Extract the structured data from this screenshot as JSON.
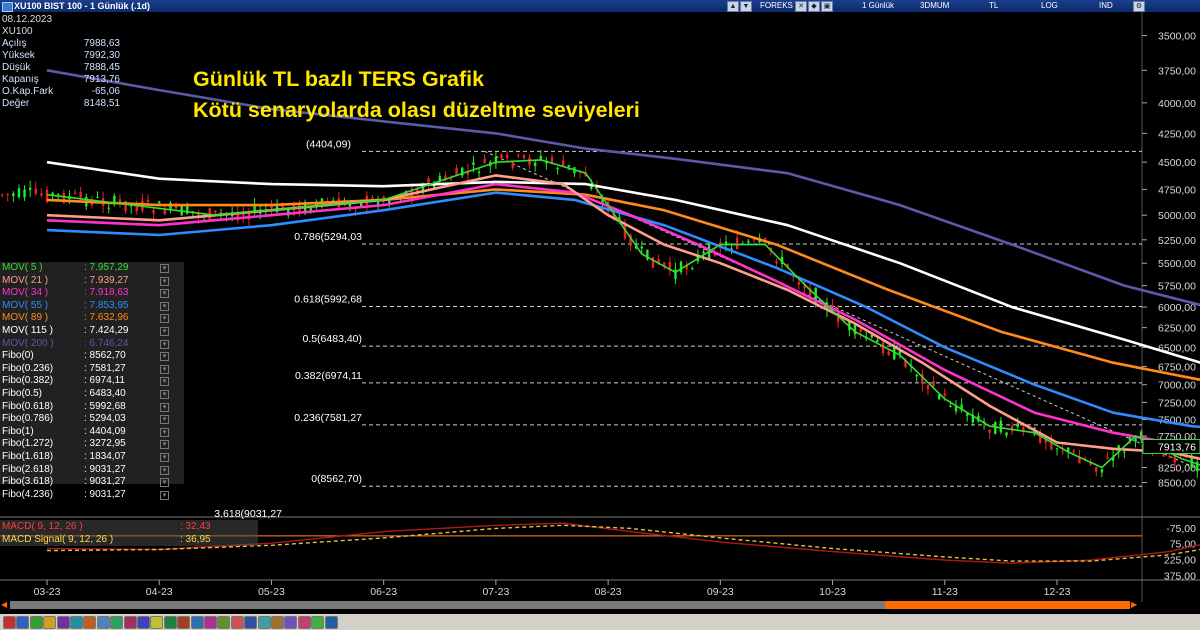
{
  "window": {
    "title": "XU100 BIST 100 - 1 Günlük (.1d)",
    "toolbar_items": [
      "FOREKS",
      "1 Günlük",
      "3DMUM",
      "TL",
      "LOG",
      "IND"
    ]
  },
  "info_panel": {
    "date": "08.12.2023",
    "symbol": "XU100",
    "rows": [
      {
        "label": "Açılış",
        "value": "7988,63"
      },
      {
        "label": "Yüksek",
        "value": "7992,30"
      },
      {
        "label": "Düşük",
        "value": "7888,45"
      },
      {
        "label": "Kapanış",
        "value": "7913,76"
      },
      {
        "label": "O.Kap.Fark",
        "value": "-65,06"
      },
      {
        "label": "Değer",
        "value": "8148,51"
      }
    ]
  },
  "headline": {
    "line1": "Günlük TL bazlı TERS Grafik",
    "line2": "Kötü senaryolarda olası düzeltme seviyeleri"
  },
  "legend": [
    {
      "label": "MOV( 5 )",
      "value": ": 7.957,29",
      "color": "#33dd33"
    },
    {
      "label": "MOV( 21 )",
      "value": ": 7.939,27",
      "color": "#ff9e8a"
    },
    {
      "label": "MOV( 34 )",
      "value": ": 7.918,63",
      "color": "#ff33cc"
    },
    {
      "label": "MOV( 55 )",
      "value": ": 7.853,95",
      "color": "#2f8cff"
    },
    {
      "label": "MOV( 89 )",
      "value": ": 7.632,96",
      "color": "#ff8a1c"
    },
    {
      "label": "MOV( 115 )",
      "value": ": 7.424,29",
      "color": "#ffffff"
    },
    {
      "label": "MOV( 200 )",
      "value": ": 6.746,24",
      "color": "#5a5aa8"
    },
    {
      "label": "Fibo(0)",
      "value": ": 8562,70",
      "color": "#ffffff"
    },
    {
      "label": "Fibo(0.236)",
      "value": ": 7581,27",
      "color": "#ffffff"
    },
    {
      "label": "Fibo(0.382)",
      "value": ": 6974,11",
      "color": "#ffffff"
    },
    {
      "label": "Fibo(0.5)",
      "value": ": 6483,40",
      "color": "#ffffff"
    },
    {
      "label": "Fibo(0.618)",
      "value": ": 5992,68",
      "color": "#ffffff"
    },
    {
      "label": "Fibo(0.786)",
      "value": ": 5294,03",
      "color": "#ffffff"
    },
    {
      "label": "Fibo(1)",
      "value": ": 4404,09",
      "color": "#ffffff"
    },
    {
      "label": "Fibo(1.272)",
      "value": ": 3272,95",
      "color": "#ffffff"
    },
    {
      "label": "Fibo(1.618)",
      "value": ": 1834,07",
      "color": "#ffffff"
    },
    {
      "label": "Fibo(2.618)",
      "value": ": 9031,27",
      "color": "#ffffff"
    },
    {
      "label": "Fibo(3.618)",
      "value": ": 9031,27",
      "color": "#ffffff"
    },
    {
      "label": "Fibo(4.236)",
      "value": ": 9031,27",
      "color": "#ffffff"
    }
  ],
  "macd_legend": [
    {
      "label": "MACD( 9, 12, 26 )",
      "value": ": 32,43",
      "color": "#ff3b3b"
    },
    {
      "label": "MACD Signal( 9, 12, 26 )",
      "value": ": 36,95",
      "color": "#ffd84a"
    }
  ],
  "chart_data": {
    "type": "line",
    "inverted_axis": true,
    "log_scale": true,
    "last_price_label": "7913,76",
    "x_ticks": [
      "03-23",
      "04-23",
      "05-23",
      "06-23",
      "07-23",
      "08-23",
      "09-23",
      "10-23",
      "11-23",
      "12-23"
    ],
    "y_ticks": [
      "3500,00",
      "3750,00",
      "4000,00",
      "4250,00",
      "4500,00",
      "4750,00",
      "5000,00",
      "5250,00",
      "5500,00",
      "5750,00",
      "6000,00",
      "6250,00",
      "6500,00",
      "6750,00",
      "7000,00",
      "7250,00",
      "7500,00",
      "7750,00",
      "8250,00",
      "8500,00"
    ],
    "y_ticks_macd": [
      "-75,00",
      "75,00",
      "225,00",
      "375,00"
    ],
    "ylim": [
      3400,
      8700
    ],
    "fibo_levels": [
      {
        "label": "(4404,09)",
        "value": 4404.09
      },
      {
        "label": "0.786(5294,03",
        "value": 5294.03
      },
      {
        "label": "0.618(5992,68",
        "value": 5992.68
      },
      {
        "label": "0.5(6483,40)",
        "value": 6483.4
      },
      {
        "label": "0.382(6974,11",
        "value": 6974.11
      },
      {
        "label": "0.236(7581,27",
        "value": 7581.27
      },
      {
        "label": "0(8562,70)",
        "value": 8562.7
      },
      {
        "label": "3.618(9031,27",
        "value": 9031.27
      }
    ],
    "series": [
      {
        "name": "MOV( 5 )",
        "color": "#33dd33",
        "points": [
          [
            0,
            4800
          ],
          [
            1.5,
            5000
          ],
          [
            3,
            4850
          ],
          [
            4,
            4500
          ],
          [
            4.4,
            4480
          ],
          [
            4.8,
            4600
          ],
          [
            5.3,
            5400
          ],
          [
            5.6,
            5600
          ],
          [
            6,
            5300
          ],
          [
            6.4,
            5300
          ],
          [
            6.8,
            5800
          ],
          [
            7.2,
            6300
          ],
          [
            7.6,
            6600
          ],
          [
            8,
            7200
          ],
          [
            8.4,
            7600
          ],
          [
            8.8,
            7700
          ],
          [
            9.1,
            8000
          ],
          [
            9.4,
            8250
          ],
          [
            9.7,
            7750
          ],
          [
            10.1,
            8100
          ],
          [
            10.5,
            8350
          ],
          [
            11,
            8300
          ],
          [
            11.4,
            7700
          ],
          [
            11.8,
            7500
          ],
          [
            12.2,
            7700
          ],
          [
            12.6,
            7800
          ],
          [
            13,
            7950
          ],
          [
            13.4,
            7900
          ]
        ]
      },
      {
        "name": "MOV( 21 )",
        "color": "#ff9e8a",
        "points": [
          [
            0,
            5000
          ],
          [
            1,
            5050
          ],
          [
            2,
            4950
          ],
          [
            3,
            4850
          ],
          [
            4,
            4620
          ],
          [
            4.6,
            4700
          ],
          [
            5,
            5000
          ],
          [
            5.5,
            5300
          ],
          [
            6,
            5500
          ],
          [
            6.6,
            5800
          ],
          [
            7.2,
            6200
          ],
          [
            7.8,
            6700
          ],
          [
            8.4,
            7300
          ],
          [
            9,
            7850
          ],
          [
            9.5,
            7950
          ],
          [
            10,
            8000
          ],
          [
            10.5,
            8200
          ],
          [
            11,
            8150
          ],
          [
            11.5,
            7800
          ],
          [
            12,
            7650
          ],
          [
            12.5,
            7750
          ],
          [
            13,
            7900
          ],
          [
            13.4,
            7940
          ]
        ]
      },
      {
        "name": "MOV( 34 )",
        "color": "#ff33cc",
        "points": [
          [
            0,
            5050
          ],
          [
            1,
            5100
          ],
          [
            2,
            5000
          ],
          [
            3,
            4900
          ],
          [
            4,
            4700
          ],
          [
            4.7,
            4780
          ],
          [
            5.2,
            5000
          ],
          [
            5.8,
            5300
          ],
          [
            6.5,
            5700
          ],
          [
            7.2,
            6150
          ],
          [
            8,
            6800
          ],
          [
            8.8,
            7400
          ],
          [
            9.5,
            7700
          ],
          [
            10,
            7850
          ],
          [
            10.5,
            8000
          ],
          [
            11,
            8000
          ],
          [
            11.5,
            7850
          ],
          [
            12,
            7700
          ],
          [
            12.5,
            7720
          ],
          [
            13,
            7870
          ],
          [
            13.4,
            7920
          ]
        ]
      },
      {
        "name": "MOV( 55 )",
        "color": "#2f8cff",
        "points": [
          [
            0,
            5150
          ],
          [
            1,
            5200
          ],
          [
            2,
            5100
          ],
          [
            3,
            4950
          ],
          [
            4,
            4780
          ],
          [
            4.7,
            4850
          ],
          [
            5.5,
            5100
          ],
          [
            6.5,
            5550
          ],
          [
            7.3,
            6000
          ],
          [
            8,
            6500
          ],
          [
            8.8,
            7000
          ],
          [
            9.5,
            7400
          ],
          [
            10.2,
            7600
          ],
          [
            11,
            7700
          ],
          [
            11.5,
            7600
          ],
          [
            12,
            7550
          ],
          [
            12.6,
            7650
          ],
          [
            13.4,
            7850
          ]
        ]
      },
      {
        "name": "MOV( 89 )",
        "color": "#ff8a1c",
        "points": [
          [
            0,
            4850
          ],
          [
            1,
            4900
          ],
          [
            2,
            4900
          ],
          [
            3,
            4850
          ],
          [
            4,
            4750
          ],
          [
            4.8,
            4800
          ],
          [
            5.5,
            4950
          ],
          [
            6.5,
            5300
          ],
          [
            7.5,
            5800
          ],
          [
            8.5,
            6300
          ],
          [
            9.5,
            6700
          ],
          [
            10.5,
            7000
          ],
          [
            11.3,
            7250
          ],
          [
            12,
            7400
          ],
          [
            12.7,
            7500
          ],
          [
            13.4,
            7600
          ]
        ]
      },
      {
        "name": "MOV( 115 )",
        "color": "#ffffff",
        "points": [
          [
            0,
            4500
          ],
          [
            1,
            4650
          ],
          [
            2,
            4700
          ],
          [
            3,
            4720
          ],
          [
            4,
            4680
          ],
          [
            4.8,
            4700
          ],
          [
            5.6,
            4850
          ],
          [
            6.6,
            5100
          ],
          [
            7.6,
            5500
          ],
          [
            8.6,
            6000
          ],
          [
            9.6,
            6400
          ],
          [
            10.5,
            6800
          ],
          [
            11.3,
            7050
          ],
          [
            12,
            7200
          ],
          [
            12.7,
            7300
          ],
          [
            13.4,
            7400
          ]
        ]
      },
      {
        "name": "MOV( 200 )",
        "color": "#5a5aa8",
        "points": [
          [
            0,
            3750
          ],
          [
            1,
            3900
          ],
          [
            2,
            4050
          ],
          [
            3,
            4150
          ],
          [
            4,
            4250
          ],
          [
            4.8,
            4380
          ],
          [
            5.6,
            4470
          ],
          [
            6.6,
            4600
          ],
          [
            7.6,
            4900
          ],
          [
            8.6,
            5300
          ],
          [
            9.6,
            5750
          ],
          [
            10.5,
            6050
          ],
          [
            11.3,
            6250
          ],
          [
            12,
            6400
          ],
          [
            12.7,
            6550
          ],
          [
            13.4,
            6700
          ]
        ]
      }
    ],
    "macd_series": [
      {
        "name": "MACD( 9, 12, 26 )",
        "color": "#ff3b3b",
        "points": [
          [
            0,
            120
          ],
          [
            1,
            130
          ],
          [
            2,
            70
          ],
          [
            3,
            -40
          ],
          [
            4,
            -100
          ],
          [
            4.6,
            -120
          ],
          [
            5.2,
            -40
          ],
          [
            6,
            60
          ],
          [
            7,
            150
          ],
          [
            8,
            230
          ],
          [
            8.6,
            260
          ],
          [
            9.3,
            230
          ],
          [
            10,
            150
          ],
          [
            10.5,
            30
          ],
          [
            11,
            -80
          ],
          [
            11.5,
            -130
          ],
          [
            12,
            -60
          ],
          [
            12.6,
            20
          ],
          [
            13.2,
            50
          ],
          [
            13.4,
            32
          ]
        ]
      },
      {
        "name": "MACD Signal( 9, 12, 26 )",
        "color": "#ffd84a",
        "points": [
          [
            0,
            140
          ],
          [
            1,
            130
          ],
          [
            2,
            90
          ],
          [
            3,
            20
          ],
          [
            4,
            -70
          ],
          [
            4.6,
            -100
          ],
          [
            5.2,
            -70
          ],
          [
            6,
            20
          ],
          [
            7,
            120
          ],
          [
            8,
            200
          ],
          [
            8.6,
            240
          ],
          [
            9.3,
            240
          ],
          [
            10,
            180
          ],
          [
            10.5,
            90
          ],
          [
            11,
            -20
          ],
          [
            11.5,
            -90
          ],
          [
            12,
            -80
          ],
          [
            12.6,
            -10
          ],
          [
            13.2,
            40
          ],
          [
            13.4,
            37
          ]
        ]
      }
    ]
  }
}
